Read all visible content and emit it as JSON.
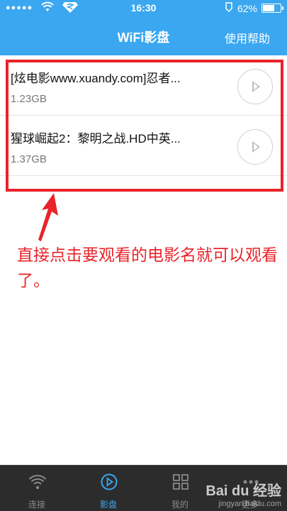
{
  "status_bar": {
    "signal": "●●●●●",
    "time": "16:30",
    "battery": "62%",
    "battery_level": 0.62
  },
  "header": {
    "title": "WiFi影盘",
    "help_label": "使用帮助"
  },
  "files": [
    {
      "name": "[炫电影www.xuandy.com]忍者...",
      "size": "1.23GB"
    },
    {
      "name": "猩球崛起2：黎明之战.HD中英...",
      "size": "1.37GB"
    }
  ],
  "annotation": {
    "text": "直接点击要观看的电影名就可以观看了。"
  },
  "tabs": [
    {
      "label": "连接",
      "icon": "wifi-icon"
    },
    {
      "label": "影盘",
      "icon": "play-circle-icon"
    },
    {
      "label": "我的",
      "icon": "grid-icon"
    },
    {
      "label": "更多",
      "icon": "more-icon"
    }
  ],
  "watermark": {
    "logo": "Bai du 经验",
    "url": "jingyan.baidu.com"
  },
  "colors": {
    "accent": "#3aa7f0",
    "highlight": "#e8242a"
  }
}
